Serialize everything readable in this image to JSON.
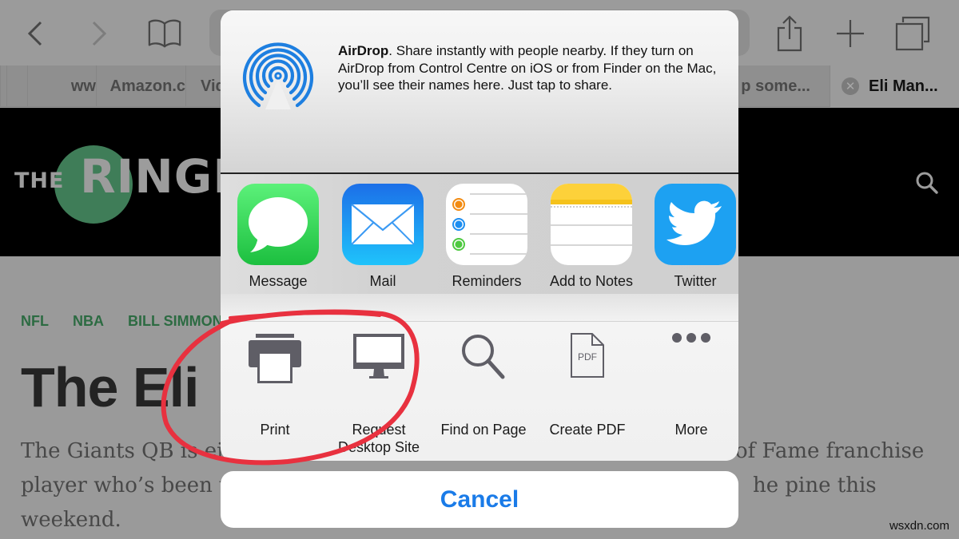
{
  "browser": {
    "toolbar": {
      "back_icon": "chevron-left",
      "forward_icon": "chevron-right",
      "bookmarks_icon": "open-book",
      "share_icon": "share-box-arrow-up",
      "new_tab_icon": "plus",
      "tabs_icon": "two-squares"
    },
    "tabs": [
      {
        "label": ""
      },
      {
        "label": ""
      },
      {
        "label": "ww"
      },
      {
        "label": "Amazon.c"
      },
      {
        "label": "Vid"
      },
      {
        "label": "p some..."
      },
      {
        "label": "Eli Man...",
        "active": true,
        "close_glyph": "✕"
      }
    ]
  },
  "site": {
    "logo_the": "THE",
    "logo_name": "RINGER",
    "search_icon": "magnifying-glass",
    "categories": [
      "NFL",
      "NBA",
      "BILL SIMMONS"
    ],
    "headline": "The Eli",
    "dek_lines_left": [
      "The Giants QB is ei",
      "player who’s been w",
      "weekend."
    ],
    "dek_lines_right": [
      "of Fame franchise",
      "he pine this"
    ],
    "watermark": "wsxdn.com"
  },
  "share_sheet": {
    "airdrop": {
      "title": "AirDrop",
      "description": ". Share instantly with people nearby. If they turn on AirDrop from Control Centre on iOS or from Finder on the Mac, you’ll see their names here. Just tap to share.",
      "accent": "#1e7fe0"
    },
    "apps": [
      {
        "label": "Message",
        "icon": "speech-bubble",
        "color": "#2ec94a"
      },
      {
        "label": "Mail",
        "icon": "envelope",
        "color": "#1f8cf5"
      },
      {
        "label": "Reminders",
        "icon": "checklist",
        "color": "#ffffff"
      },
      {
        "label": "Add to Notes",
        "icon": "notepad",
        "color": "#ffd233"
      },
      {
        "label": "Twitter",
        "icon": "bird",
        "color": "#1da1f2"
      }
    ],
    "actions": [
      {
        "label": "Print",
        "icon": "printer"
      },
      {
        "label": "Request Desktop Site",
        "label_line1": "Request",
        "label_line2": "Desktop Site",
        "icon": "desktop-monitor"
      },
      {
        "label": "Find on Page",
        "icon": "magnifying-glass"
      },
      {
        "label": "Create PDF",
        "icon": "pdf-document",
        "icon_text": "PDF"
      },
      {
        "label": "More",
        "icon": "ellipsis"
      }
    ],
    "cancel_label": "Cancel",
    "cancel_color": "#1a7be8"
  },
  "annotation": {
    "type": "hand-drawn-circle",
    "target": "Print / Request Desktop Site",
    "color": "#e8313f"
  }
}
